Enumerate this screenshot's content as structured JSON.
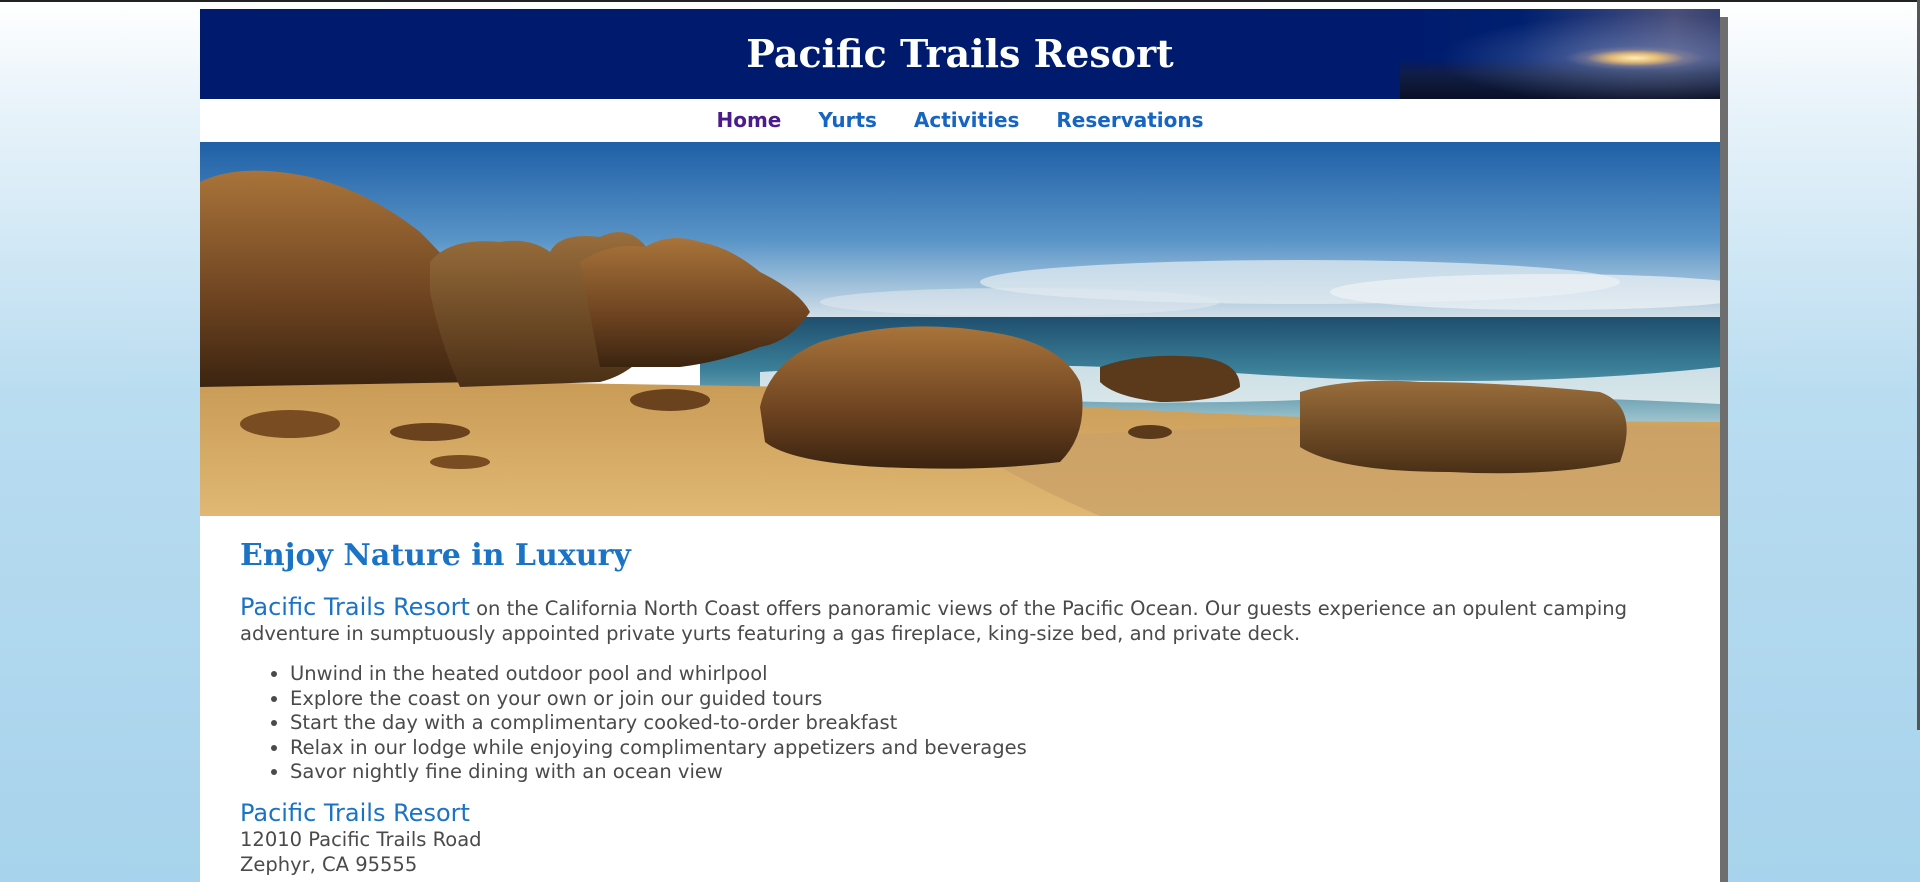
{
  "header": {
    "title": "Pacific Trails Resort"
  },
  "nav": {
    "items": [
      {
        "label": "Home"
      },
      {
        "label": "Yurts"
      },
      {
        "label": "Activities"
      },
      {
        "label": "Reservations"
      }
    ]
  },
  "hero": {
    "alt": "Pacific Trails Resort beach with rocks and ocean"
  },
  "main": {
    "heading": "Enjoy Nature in Luxury",
    "intro_brand": "Pacific Trails Resort",
    "intro_text": " on the California North Coast offers panoramic views of the Pacific Ocean. Our guests experience an opulent camping adventure in sumptuously appointed private yurts featuring a gas fireplace, king-size bed, and private deck.",
    "features": [
      "Unwind in the heated outdoor pool and whirlpool",
      "Explore the coast on your own or join our guided tours",
      "Start the day with a complimentary cooked-to-order breakfast",
      "Relax in our lodge while enjoying complimentary appetizers and beverages",
      "Savor nightly fine dining with an ocean view"
    ],
    "address": {
      "name": "Pacific Trails Resort",
      "street": "12010 Pacific Trails Road",
      "city": "Zephyr, CA 95555"
    }
  },
  "colors": {
    "header_bg": "#001b6e",
    "link": "#1665c0",
    "visited_link": "#4b1b8c",
    "accent": "#1b73c6",
    "text": "#4a4a4a"
  }
}
